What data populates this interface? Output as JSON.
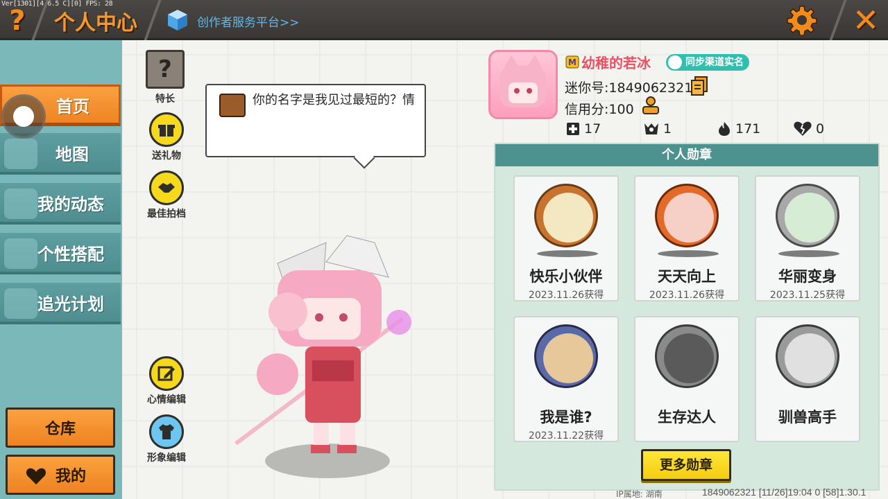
{
  "debug_text": "Ver[1301][4.6.5 C][0] FPS: 28",
  "header": {
    "title": "个人中心",
    "creator_link": "创作者服务平台>>",
    "help_icon": "question-mark-icon",
    "settings_icon": "gear-icon",
    "close_icon": "close-icon",
    "accent_color": "#f59a2a"
  },
  "sidebar": {
    "items": [
      {
        "label": "首页",
        "active": true
      },
      {
        "label": "地图",
        "active": false
      },
      {
        "label": "我的动态",
        "active": false
      },
      {
        "label": "个性搭配",
        "active": false
      },
      {
        "label": "追光计划",
        "active": false
      }
    ],
    "warehouse_label": "仓库",
    "mine_label": "我的"
  },
  "actions": {
    "specialty": "特长",
    "gift": "送礼物",
    "best_shot": "最佳拍档",
    "mood_edit": "心情编辑",
    "image_edit": "形象编辑"
  },
  "bubble": {
    "text": "你的名字是我见过最短的？情"
  },
  "profile": {
    "nickname": "幼稚的若冰",
    "realname_badge": "同步渠道实名",
    "mini_id": "迷你号:1849062321",
    "credit": "信用分:100",
    "stats": {
      "plus": "17",
      "fans": "1",
      "fire": "171",
      "likes": "0"
    }
  },
  "medals": {
    "title": "个人勋章",
    "items": [
      {
        "name": "快乐小伙伴",
        "date": "2023.11.26获得"
      },
      {
        "name": "天天向上",
        "date": "2023.11.26获得"
      },
      {
        "name": "华丽变身",
        "date": "2023.11.25获得"
      },
      {
        "name": "我是谁?",
        "date": "2023.11.22获得"
      },
      {
        "name": "生存达人",
        "date": ""
      },
      {
        "name": "驯兽高手",
        "date": ""
      }
    ],
    "more_label": "更多勋章"
  },
  "footer": {
    "ip": "IP属地: 湖南",
    "info": "1849062321    [11/26]19:04 0    [58]1.30.1"
  }
}
